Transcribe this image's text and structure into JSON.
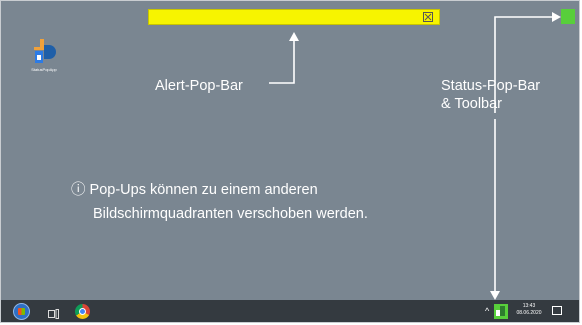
{
  "desktop": {
    "app_icon": {
      "icon": "status-pop-app-icon",
      "label": "StatusPopApp"
    },
    "alert_bar": {
      "close_icon": "close-box-icon",
      "color": "#f7f400"
    },
    "status_square": {
      "color": "#58cf3b"
    }
  },
  "annotations": {
    "alert_label": "Alert-Pop-Bar",
    "status_label_line1": "Status-Pop-Bar",
    "status_label_line2": "& Toolbar",
    "info_symbol": "ⓘ",
    "info_line1": "Pop-Ups können zu einem anderen",
    "info_line2": "Bildschirmquadranten verschoben werden."
  },
  "taskbar": {
    "start_icon": "windows-start-icon",
    "taskview_icon": "task-view-icon",
    "browser_icon": "chrome-icon",
    "tray_chevron": "^",
    "tray_app_icon": "status-pop-tray-icon",
    "time": "13:43",
    "date": "08.06.2020",
    "notification_icon": "notification-icon"
  },
  "colors": {
    "desktop": "#7a8691",
    "taskbar": "#343a40",
    "arrow": "#ffffff"
  }
}
